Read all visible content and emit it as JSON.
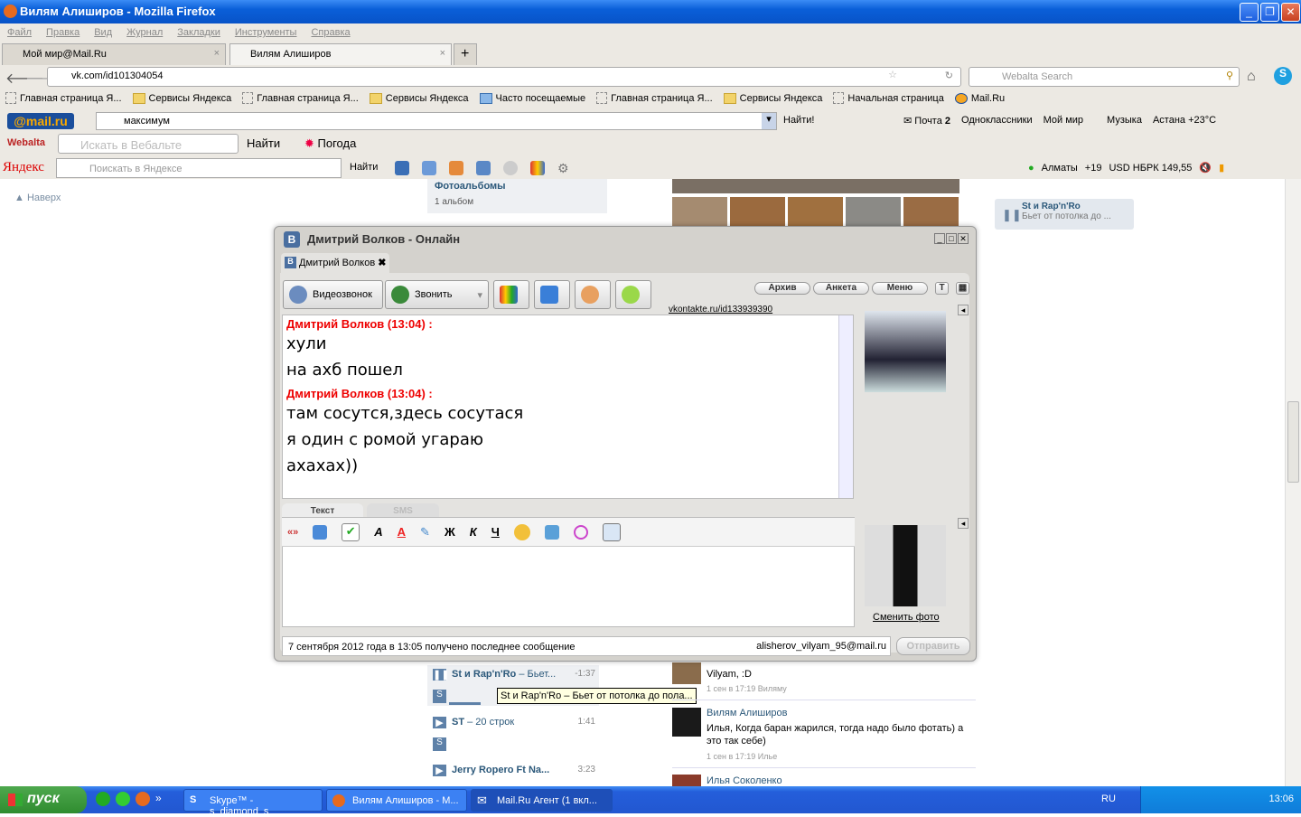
{
  "window": {
    "title": "Вилям Алиширов - Mozilla Firefox"
  },
  "menu": [
    "Файл",
    "Правка",
    "Вид",
    "Журнал",
    "Закладки",
    "Инструменты",
    "Справка"
  ],
  "tabs": [
    {
      "label": "Мой мир@Mail.Ru"
    },
    {
      "label": "Вилям Алиширов"
    }
  ],
  "url": "vk.com/id101304054",
  "search_placeholder": "Webalta Search",
  "bookmarks": [
    "Главная страница Я...",
    "Сервисы Яндекса",
    "Главная страница Я...",
    "Сервисы Яндекса",
    "Часто посещаемые",
    "Главная страница Я...",
    "Сервисы Яндекса",
    "Начальная страница",
    "Mail.Ru"
  ],
  "mailru_bar": {
    "logo": "@mail.ru",
    "query": "максимум",
    "find": "Найти!",
    "mail": "Почта",
    "mail_count": "2",
    "ok": "Одноклассники",
    "myworld": "Мой мир",
    "music": "Музыка",
    "weather": "Астана +23°C"
  },
  "webalta_bar": {
    "logo": "Webalta",
    "placeholder": "Искать в Вебальте",
    "find": "Найти",
    "weather": "Погода"
  },
  "yandex_bar": {
    "logo": "Яндекс",
    "placeholder": "Поискать в Яндексе",
    "find": "Найти",
    "city": "Алматы",
    "temp": "+19",
    "currency": "USD НБРК 149,55"
  },
  "page": {
    "up": "Наверх",
    "albums": "Фотоальбомы",
    "albums_count": "1 альбом",
    "player_artist": "St и Rap'n'Ro",
    "player_track": "Бьет от потолка до ...",
    "tracks": [
      {
        "artist": "St и Rap'n'Ro",
        "title": " – Бьет...",
        "time": "-1:37"
      },
      {
        "artist": "ST",
        "title": " – 20 строк",
        "time": "1:41"
      },
      {
        "artist": "Jerry Ropero Ft Na...",
        "title": "",
        "time": "3:23"
      }
    ],
    "tooltip": "St и Rap'n'Ro – Бьет от потолка до пола...",
    "comments": [
      {
        "author": "",
        "text": "Vilyam, :D",
        "meta": "1 сен в 17:19 Виляму"
      },
      {
        "author": "Вилям Алиширов",
        "text": "Илья, Когда баран жарился, тогда надо было фотать) а это так себе)",
        "meta": "1 сен в 17:19 Илье"
      },
      {
        "author": "Илья Соколенко",
        "text": "",
        "meta": ""
      }
    ]
  },
  "chat": {
    "title": "Дмитрий Волков - Онлайн",
    "tab": "Дмитрий Волков",
    "video": "Видеозвонок",
    "call": "Звонить",
    "archive": "Архив",
    "profile": "Анкета",
    "menu": "Меню",
    "link": "vkontakte.ru/id133939390",
    "messages": [
      {
        "header": "Дмитрий Волков (13:04) :",
        "lines": [
          "хули",
          "на ахб пошел"
        ]
      },
      {
        "header": "Дмитрий Волков (13:04) :",
        "lines": [
          "там сосутся,здесь сосутася",
          "я один с ромой угараю",
          "ахахах))"
        ]
      }
    ],
    "tab_text": "Текст",
    "tab_sms": "SMS",
    "quote": "«»",
    "bold": "Ж",
    "italic": "К",
    "underline": "Ч",
    "change_photo": "Сменить фото",
    "status": "7 сентября 2012 года в 13:05 получено последнее сообщение",
    "email": "alisherov_vilyam_95@mail.ru",
    "send": "Отправить"
  },
  "taskbar": {
    "start": "пуск",
    "tasks": [
      "Skype™ - s_diamond_s",
      "Вилям Алиширов - M...",
      "Mail.Ru Агент (1 вкл..."
    ],
    "lang": "RU",
    "clock": "13:06"
  }
}
